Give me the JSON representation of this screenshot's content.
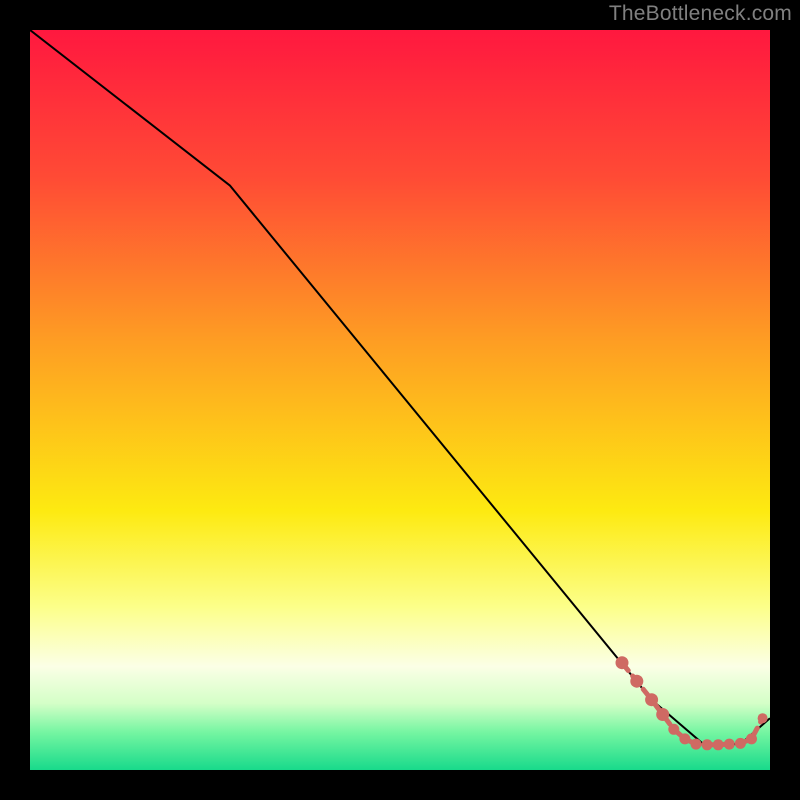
{
  "watermark": "TheBottleneck.com",
  "colors": {
    "line": "#000000",
    "marker_fill": "#cf6a63",
    "marker_stroke": "#cf6a63",
    "frame_bg": "#000000"
  },
  "chart_data": {
    "type": "line",
    "title": "",
    "xlabel": "",
    "ylabel": "",
    "xlim": [
      0,
      100
    ],
    "ylim": [
      0,
      100
    ],
    "grid": false,
    "legend": false,
    "gradient_stops": [
      {
        "offset": 0,
        "color": "#ff183f"
      },
      {
        "offset": 20,
        "color": "#ff4b35"
      },
      {
        "offset": 42,
        "color": "#fe9d23"
      },
      {
        "offset": 65,
        "color": "#fdea11"
      },
      {
        "offset": 78,
        "color": "#fcff8a"
      },
      {
        "offset": 86,
        "color": "#fbffe6"
      },
      {
        "offset": 91,
        "color": "#d4ffc7"
      },
      {
        "offset": 95,
        "color": "#73f5a1"
      },
      {
        "offset": 100,
        "color": "#18da8b"
      }
    ],
    "series": [
      {
        "name": "black-curve",
        "style": "solid-thin",
        "x": [
          0,
          27,
          84,
          91,
          96,
          100
        ],
        "y": [
          100,
          79,
          9.5,
          3.5,
          3.5,
          7
        ]
      },
      {
        "name": "marker-curve",
        "style": "markers-dashed",
        "x": [
          80,
          82,
          84,
          85.5,
          87,
          88.5,
          90,
          91.5,
          93,
          94.5,
          96,
          97.5,
          99
        ],
        "y": [
          14.5,
          12,
          9.5,
          7.5,
          5.5,
          4.2,
          3.5,
          3.4,
          3.4,
          3.5,
          3.6,
          4.2,
          7
        ]
      }
    ]
  }
}
